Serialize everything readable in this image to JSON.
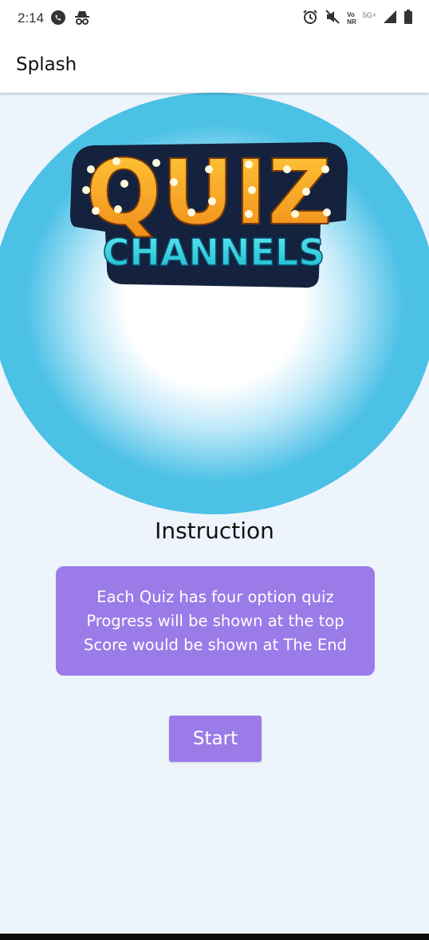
{
  "status_bar": {
    "time": "2:14",
    "volte_top": "Vo",
    "volte_bottom": "NR",
    "network": "5G+"
  },
  "app_bar": {
    "title": "Splash"
  },
  "logo": {
    "line1": "QUIZ",
    "line2": "CHANNELS"
  },
  "instruction": {
    "title": "Instruction",
    "lines": [
      "Each Quiz has four option quiz",
      "Progress will be shown at the top",
      "Score would be shown at The End"
    ]
  },
  "start_button": {
    "label": "Start"
  },
  "colors": {
    "accent": "#9b7be8",
    "hero_blue": "#4cc1e6",
    "background": "#eef4fb",
    "logo_orange": "#f5a623",
    "logo_cyan": "#2fd3e0"
  }
}
